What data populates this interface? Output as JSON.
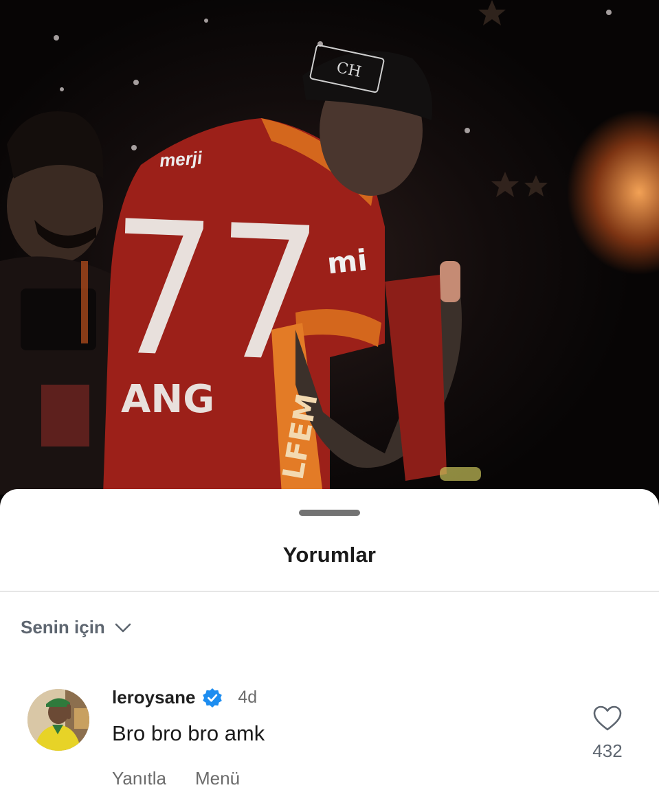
{
  "photo": {
    "jersey_number": "77",
    "jersey_name": "ANG",
    "sponsor_chest": "merji",
    "sleeve_text": "mi",
    "side_text": "LFEM",
    "cap_text": "CH"
  },
  "sheet": {
    "title": "Yorumlar"
  },
  "filter": {
    "label": "Senin için",
    "icon": "chevron-down-icon"
  },
  "comment": {
    "username": "leroysane",
    "verified": true,
    "time": "4d",
    "text": "Bro bro bro amk",
    "reply_label": "Yanıtla",
    "menu_label": "Menü",
    "like_count": "432",
    "like_icon": "heart-outline-icon"
  },
  "colors": {
    "jersey_red": "#b8261e",
    "jersey_orange": "#e67a22",
    "verified_blue": "#1d8df0",
    "muted_text": "#6b6b6b"
  }
}
